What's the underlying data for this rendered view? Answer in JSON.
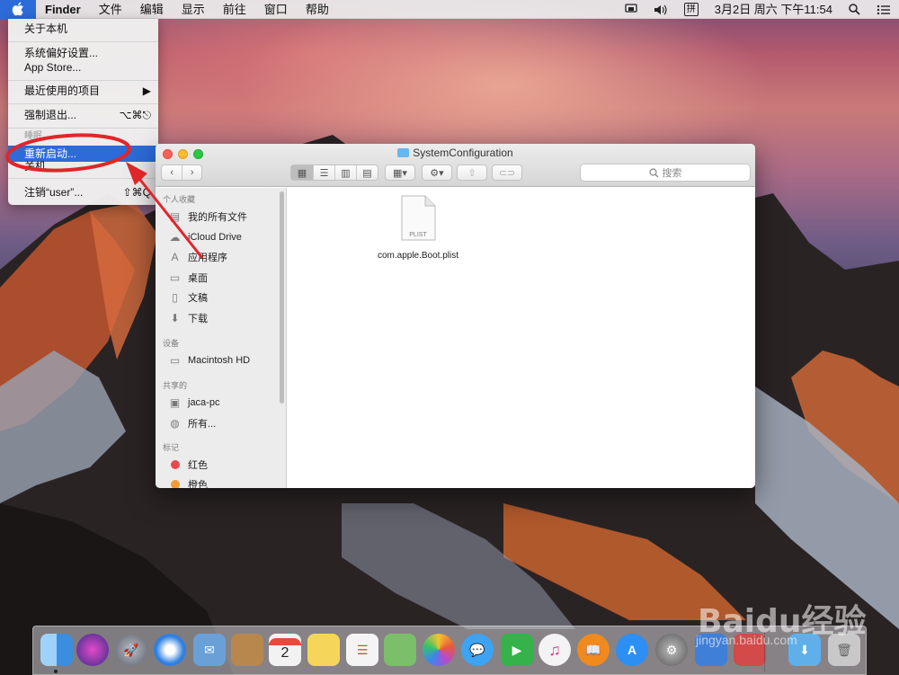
{
  "menubar": {
    "app_name": "Finder",
    "menus": [
      "文件",
      "编辑",
      "显示",
      "前往",
      "窗口",
      "帮助"
    ],
    "ime": "拼",
    "clock": "3月2日 周六 下午11:54"
  },
  "apple_menu": {
    "about": "关于本机",
    "prefs": "系统偏好设置...",
    "appstore": "App Store...",
    "recent": "最近使用的项目",
    "force_quit": "强制退出...",
    "force_quit_shortcut": "⌥⌘⎋",
    "sleep": "睡眠",
    "restart": "重新启动...",
    "shutdown": "关机...",
    "logout": "注销“user”...",
    "logout_shortcut": "⇧⌘Q"
  },
  "finder": {
    "title": "SystemConfiguration",
    "search_placeholder": "搜索",
    "sidebar": {
      "favorites_header": "个人收藏",
      "favorites": [
        "我的所有文件",
        "iCloud Drive",
        "应用程序",
        "桌面",
        "文稿",
        "下载"
      ],
      "devices_header": "设备",
      "devices": [
        "Macintosh HD"
      ],
      "shared_header": "共享的",
      "shared": [
        "jaca-pc",
        "所有..."
      ],
      "tags_header": "标记",
      "tags": [
        {
          "name": "红色",
          "color": "#e9474c"
        },
        {
          "name": "橙色",
          "color": "#f39a35"
        }
      ]
    },
    "file": {
      "name": "com.apple.Boot.plist",
      "badge": "PLIST"
    }
  },
  "dock": {
    "apps": [
      {
        "icon": "finder-icon",
        "color": "#3b8de0"
      },
      {
        "icon": "siri-icon",
        "color": "#5b3fb0"
      },
      {
        "icon": "launchpad-icon",
        "color": "#8a8f9a"
      },
      {
        "icon": "safari-icon",
        "color": "#2f7fe0"
      },
      {
        "icon": "mail-icon",
        "color": "#6aa0d8"
      },
      {
        "icon": "contacts-icon",
        "color": "#b8874e"
      },
      {
        "icon": "calendar-icon",
        "color": "#f2f2f2"
      },
      {
        "icon": "notes-icon",
        "color": "#f5d65a"
      },
      {
        "icon": "reminders-icon",
        "color": "#f4f4f4"
      },
      {
        "icon": "maps-icon",
        "color": "#7bbf6a"
      },
      {
        "icon": "photos-icon",
        "color": "#f4f4f4"
      },
      {
        "icon": "messages-icon",
        "color": "#3ea3f3"
      },
      {
        "icon": "facetime-icon",
        "color": "#35b34a"
      },
      {
        "icon": "itunes-icon",
        "color": "#f3f3f3"
      },
      {
        "icon": "ibooks-icon",
        "color": "#f08a1e"
      },
      {
        "icon": "appstore-icon",
        "color": "#2c8ff3"
      },
      {
        "icon": "system-preferences-icon",
        "color": "#7d7d7d"
      },
      {
        "icon": "app-icon",
        "color": "#3f7fd8"
      },
      {
        "icon": "app-icon-2",
        "color": "#d24a4a"
      },
      {
        "icon": "downloads-folder-icon",
        "color": "#5fb0ea"
      },
      {
        "icon": "trash-icon",
        "color": "#d8d8d8"
      }
    ],
    "calendar_day": "2"
  },
  "watermark": {
    "brand": "Baidu经验",
    "url": "jingyan.baidu.com"
  }
}
